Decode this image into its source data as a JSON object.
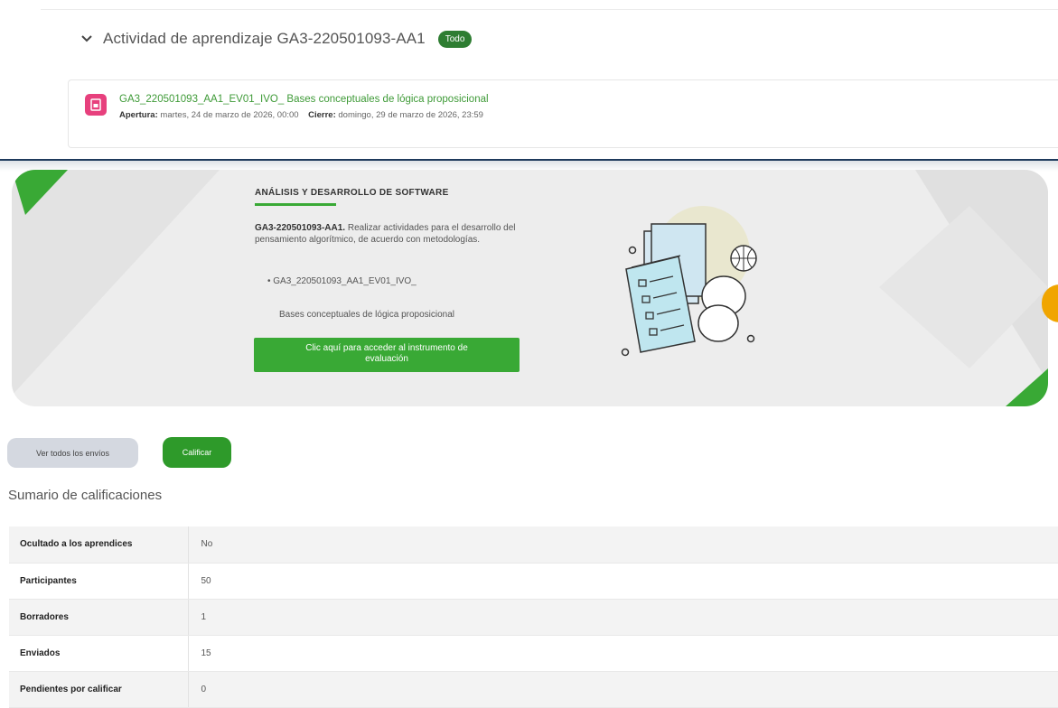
{
  "section": {
    "title": "Actividad de aprendizaje GA3-220501093-AA1",
    "badge": "Todo"
  },
  "activity": {
    "icon": "assignment-icon",
    "title": "GA3_220501093_AA1_EV01_IVO_ Bases conceptuales de lógica proposicional",
    "open_label": "Apertura:",
    "open_value": "martes, 24 de marzo de 2026, 00:00",
    "close_label": "Cierre:",
    "close_value": "domingo, 29 de marzo de 2026, 23:59"
  },
  "banner": {
    "program": "ANÁLISIS Y DESARROLLO DE SOFTWARE",
    "code": "GA3-220501093-AA1.",
    "description": "Realizar actividades para el desarrollo del pensamiento algorítmico, de acuerdo con metodologías.",
    "bullet": "GA3_220501093_AA1_EV01_IVO_",
    "bullet_sub": "Bases conceptuales de lógica proposicional",
    "button_line1": "Clic aquí para acceder al instrumento de",
    "button_line2": "evaluación"
  },
  "actions": {
    "view_all": "Ver todos los envíos",
    "grade": "Calificar"
  },
  "summary": {
    "heading": "Sumario de calificaciones",
    "rows": [
      {
        "label": "Ocultado a los aprendices",
        "value": "No"
      },
      {
        "label": "Participantes",
        "value": "50"
      },
      {
        "label": "Borradores",
        "value": "1"
      },
      {
        "label": "Enviados",
        "value": "15"
      },
      {
        "label": "Pendientes por calificar",
        "value": "0"
      }
    ]
  },
  "colors": {
    "accent_green": "#39a935",
    "badge_green": "#2e7d32",
    "link_green": "#3e9a37",
    "icon_pink": "#e7407d"
  }
}
